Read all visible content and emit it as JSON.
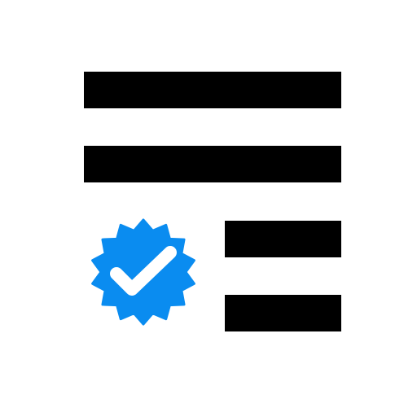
{
  "icon": {
    "name": "verified-list-icon",
    "colors": {
      "background": "#ffffff",
      "line": "#000000",
      "badge": "#0a8cf0",
      "check": "#ffffff"
    },
    "lines": [
      {
        "name": "list-line-1"
      },
      {
        "name": "list-line-2"
      },
      {
        "name": "list-line-3"
      },
      {
        "name": "list-line-4"
      }
    ],
    "badge": {
      "name": "verified-badge-icon",
      "points": 14
    }
  }
}
